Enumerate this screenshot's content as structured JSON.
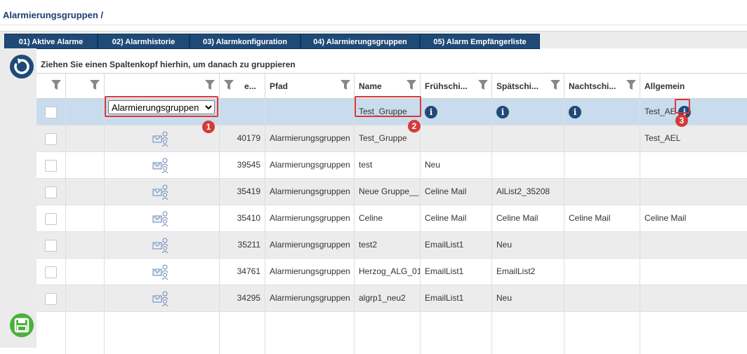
{
  "breadcrumb": "Alarmierungsgruppen /",
  "tabs": [
    {
      "label": "01) Aktive Alarme"
    },
    {
      "label": "02) Alarmhistorie"
    },
    {
      "label": "03) Alarmkonfiguration"
    },
    {
      "label": "04) Alarmierungsgruppen"
    },
    {
      "label": "05) Alarm Empfängerliste"
    }
  ],
  "group_hint": "Ziehen Sie einen Spaltenkopf hierhin, um danach zu gruppieren",
  "columns": {
    "id": "e...",
    "path": "Pfad",
    "name": "Name",
    "early": "Frühschi...",
    "late": "Spätschi...",
    "night": "Nachtschi...",
    "general": "Allgemein"
  },
  "edit_row": {
    "path_select_value": "Alarmierungsgruppen",
    "path_options": [
      "Alarmierungsgruppen"
    ],
    "name": "Test_Gruppe",
    "general": "Test_AE"
  },
  "markers": [
    "1",
    "2",
    "3"
  ],
  "rows": [
    {
      "id": "40179",
      "path": "Alarmierungsgruppen",
      "name": "Test_Gruppe",
      "early": "",
      "late": "",
      "night": "",
      "general": "Test_AEL"
    },
    {
      "id": "39545",
      "path": "Alarmierungsgruppen",
      "name": "test",
      "early": "Neu",
      "late": "",
      "night": "",
      "general": ""
    },
    {
      "id": "35419",
      "path": "Alarmierungsgruppen",
      "name": "Neue Gruppe__",
      "early": "Celine Mail",
      "late": "AlList2_35208",
      "night": "",
      "general": ""
    },
    {
      "id": "35410",
      "path": "Alarmierungsgruppen",
      "name": "Celine",
      "early": "Celine Mail",
      "late": "Celine Mail",
      "night": "Celine Mail",
      "general": "Celine Mail"
    },
    {
      "id": "35211",
      "path": "Alarmierungsgruppen",
      "name": "test2",
      "early": "EmailList1",
      "late": "Neu",
      "night": "",
      "general": ""
    },
    {
      "id": "34761",
      "path": "Alarmierungsgruppen",
      "name": "Herzog_ALG_01",
      "early": "EmailList1",
      "late": "EmailList2",
      "night": "",
      "general": ""
    },
    {
      "id": "34295",
      "path": "Alarmierungsgruppen",
      "name": "algrp1_neu2",
      "early": "EmailList1",
      "late": "Neu",
      "night": "",
      "general": ""
    }
  ],
  "colors": {
    "accent": "#1f4a78",
    "highlight": "#c9dced",
    "marker": "#d63a3a",
    "save": "#4caf3c"
  }
}
